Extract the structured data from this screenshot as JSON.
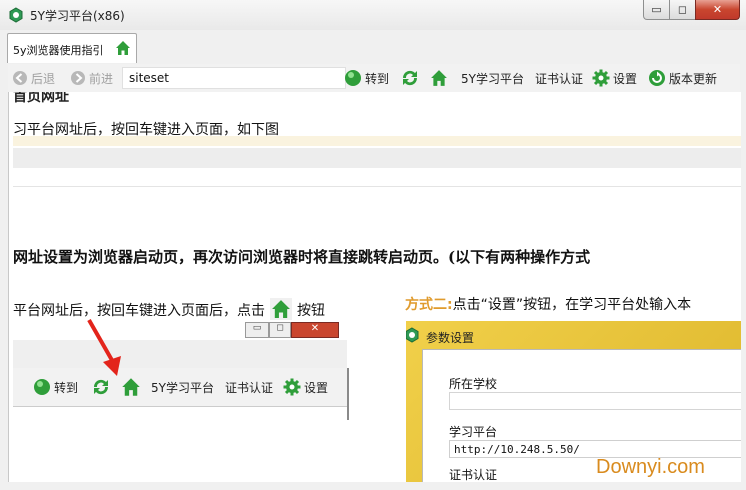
{
  "window": {
    "title": "5Y学习平台(x86)",
    "controls": {
      "minimize": "▭",
      "maximize": "◻",
      "close": "✕"
    }
  },
  "tabs": [
    {
      "label": "5y浏览器使用指引",
      "icon": "home-icon"
    }
  ],
  "toolbar": {
    "back_label": "后退",
    "forward_label": "前进",
    "url_value": "siteset",
    "go_label": "转到",
    "refresh_icon": "refresh-icon",
    "home_icon": "home-icon",
    "platform_label": "5Y学习平台",
    "cert_label": "证书认证",
    "settings_label": "设置",
    "update_label": "版本更新"
  },
  "content": {
    "clipped_heading": "首页网址",
    "para1": "习平台网址后，按回车键进入页面，如下图",
    "heading2": "网址设置为浏览器启动页，再次访问浏览器时将直接跳转启动页。(以下有两种操作方式",
    "para2_a": "平台网址后，按回车键进入页面后，点击",
    "para2_b": "按钮",
    "way2_tag": "方式二:",
    "way2_text": "点击“设置”按钮，在学习平台处输入本",
    "embedded_toolbar": {
      "go_label": "转到",
      "platform_label": "5Y学习平台",
      "cert_label": "证书认证",
      "settings_label": "设置"
    },
    "dialog": {
      "title": "参数设置",
      "school_label": "所在学校",
      "platform_label": "学习平台",
      "platform_value": "http://10.248.5.50/",
      "cert_label": "证书认证"
    }
  },
  "watermark": "Downyi.com",
  "colors": {
    "accent_green": "#2f9e3a",
    "orange": "#e09b2d"
  }
}
